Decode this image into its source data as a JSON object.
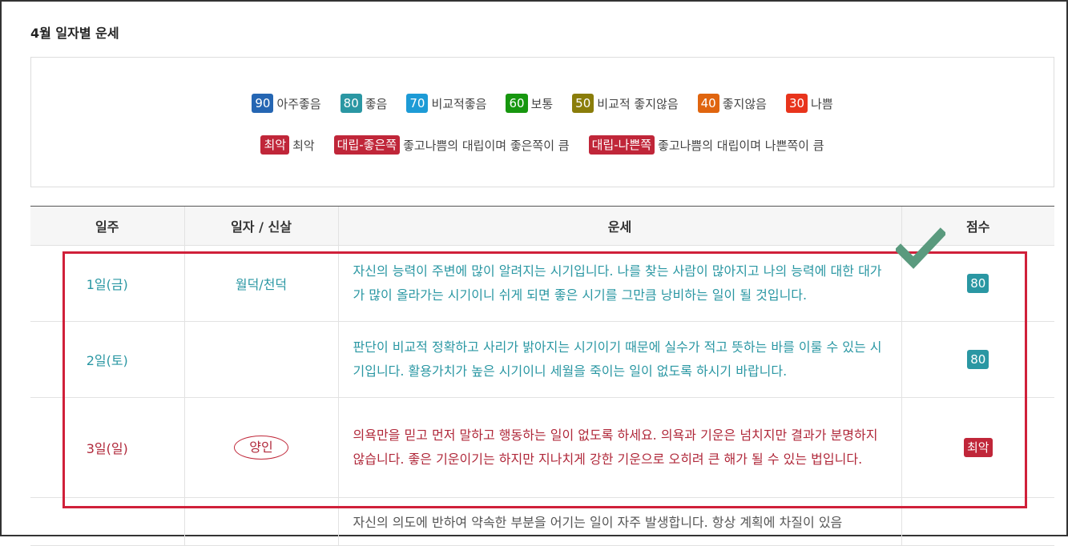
{
  "page": {
    "title": "4월 일자별 운세"
  },
  "legend": {
    "row1": [
      {
        "badge": "90",
        "label": "아주좋음",
        "color": "#2566b3"
      },
      {
        "badge": "80",
        "label": "좋음",
        "color": "#2a97a3"
      },
      {
        "badge": "70",
        "label": "비교적좋음",
        "color": "#1d9bd6"
      },
      {
        "badge": "60",
        "label": "보통",
        "color": "#17970f"
      },
      {
        "badge": "50",
        "label": "비교적 좋지않음",
        "color": "#8a7d0a"
      },
      {
        "badge": "40",
        "label": "좋지않음",
        "color": "#e0650f"
      },
      {
        "badge": "30",
        "label": "나쁨",
        "color": "#e8341c"
      }
    ],
    "row2": [
      {
        "badge": "최악",
        "label": "최악",
        "color": "#c02639"
      },
      {
        "badge": "대립-좋은쪽",
        "label": "좋고나쁨의 대립이며 좋은쪽이 큼",
        "color": "#c02639"
      },
      {
        "badge": "대립-나쁜쪽",
        "label": "좋고나쁨의 대립이며 나쁜쪽이 큼",
        "color": "#c02639"
      }
    ]
  },
  "table": {
    "headers": [
      "일주",
      "일자 / 신살",
      "운세",
      "점수"
    ],
    "rows": [
      {
        "day": "1일(금)",
        "shinsal": "월덕/천덕",
        "fortune": "자신의 능력이 주변에 많이 알려지는 시기입니다. 나를 찾는 사람이 많아지고 나의 능력에 대한 대가가 많이 올라가는 시기이니 쉬게 되면 좋은 시기를 그만큼 낭비하는 일이 될 것입니다.",
        "score": "80",
        "score_color": "#2a97a3"
      },
      {
        "day": "2일(토)",
        "shinsal": "",
        "fortune": "판단이 비교적 정확하고 사리가 밝아지는 시기이기 때문에 실수가 적고 뜻하는 바를 이룰 수 있는 시기입니다. 활용가치가 높은 시기이니 세월을 죽이는 일이 없도록 하시기 바랍니다.",
        "score": "80",
        "score_color": "#2a97a3"
      },
      {
        "day": "3일(일)",
        "shinsal": "양인",
        "fortune": "의욕만을 믿고 먼저 말하고 행동하는 일이 없도록 하세요. 의욕과 기운은 넘치지만 결과가 분명하지 않습니다. 좋은 기운이기는 하지만 지나치게 강한 기운으로 오히려 큰 해가 될 수 있는 법입니다.",
        "score": "최악",
        "score_color": "#c02639"
      },
      {
        "day": "",
        "shinsal": "",
        "fortune": "자신의 의도에 반하여 약속한 부분을 어기는 일이 자주 발생합니다. 항상 계획에 차질이 있음",
        "score": "",
        "score_color": "#2a97a3"
      }
    ]
  },
  "colors": {
    "highlight": "#d0203a",
    "check": "#5a9a7e"
  }
}
